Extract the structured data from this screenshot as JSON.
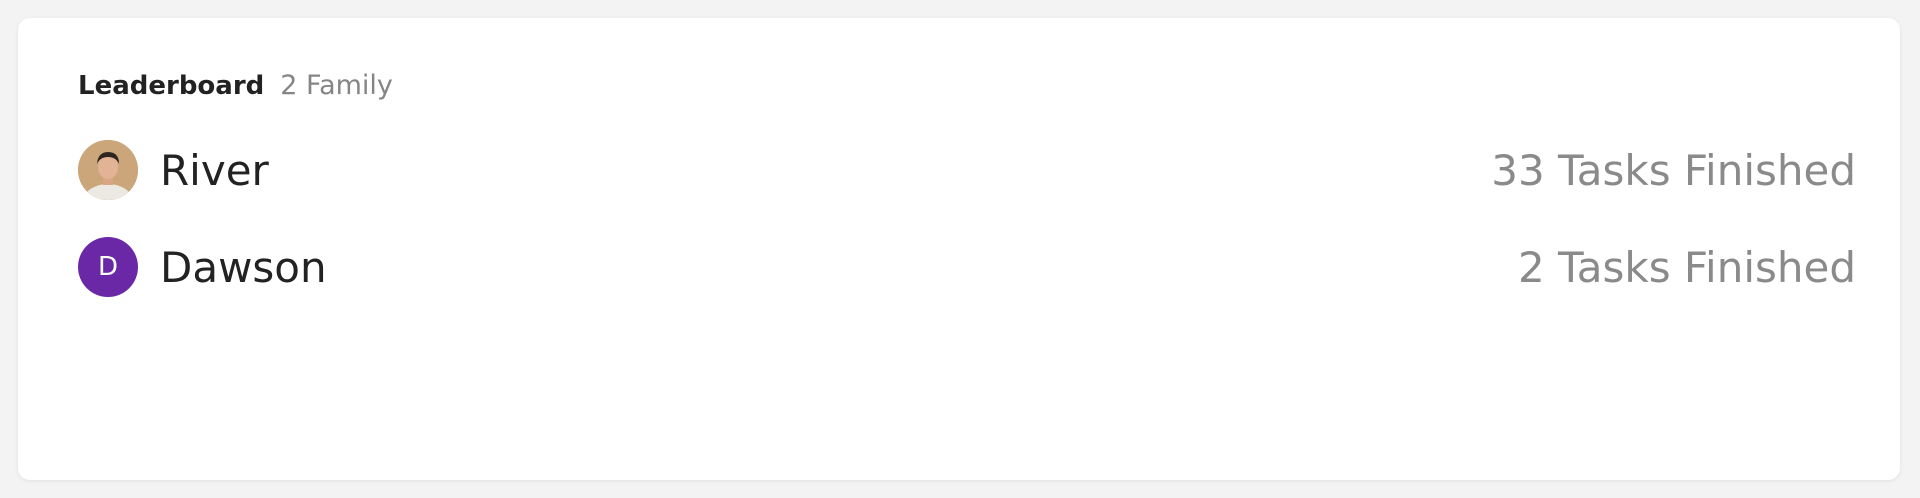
{
  "leaderboard": {
    "title": "Leaderboard",
    "count_label": "2 Family",
    "entries": [
      {
        "name": "River",
        "avatar": "photo-avatar",
        "tasks_label": "33 Tasks Finished"
      },
      {
        "name": "Dawson",
        "avatar_initial": "D",
        "avatar_color": "#6a28a6",
        "tasks_label": "2 Tasks Finished"
      }
    ]
  }
}
